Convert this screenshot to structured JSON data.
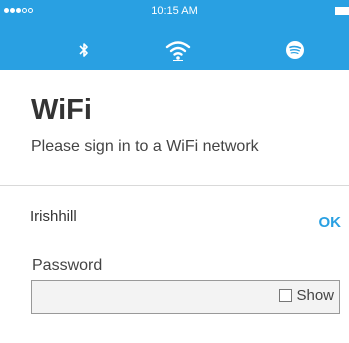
{
  "status_bar": {
    "time": "10:15 AM",
    "signal_dots_filled": 3,
    "signal_dots_total": 5
  },
  "top_tabs": [
    {
      "icon": "bluetooth-icon"
    },
    {
      "icon": "wifi-icon",
      "selected": true
    },
    {
      "icon": "spotify-icon"
    }
  ],
  "colors": {
    "accent": "#29a0e2",
    "text": "#333333"
  },
  "page": {
    "title": "WiFi",
    "subtitle": "Please sign in to a WiFi network"
  },
  "network": {
    "name": "Irishhill",
    "ok_label": "OK"
  },
  "password": {
    "label": "Password",
    "value": "",
    "show_label": "Show",
    "show_checked": false
  }
}
